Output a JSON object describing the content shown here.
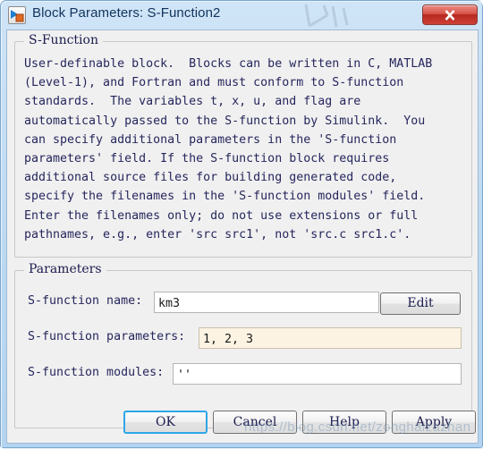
{
  "window": {
    "title": "Block Parameters: S-Function2",
    "icon": "simulink-block-icon",
    "close_label": "x",
    "frame_color": "#b3d4f0",
    "client_bg": "#f0f0f0"
  },
  "sfunction_group": {
    "legend": "S-Function",
    "description": "User-definable block.  Blocks can be written in C, MATLAB\n(Level-1), and Fortran and must conform to S-function\nstandards.  The variables t, x, u, and flag are\nautomatically passed to the S-function by Simulink.  You\ncan specify additional parameters in the 'S-function\nparameters' field. If the S-function block requires\nadditional source files for building generated code,\nspecify the filenames in the 'S-function modules' field.\nEnter the filenames only; do not use extensions or full\npathnames, e.g., enter 'src src1', not 'src.c src1.c'."
  },
  "parameters_group": {
    "legend": "Parameters",
    "fields": [
      {
        "label": "S-function name:",
        "value": "km3",
        "placeholder": "",
        "edited": false
      },
      {
        "label": "S-function parameters:",
        "value": "1, 2, 3",
        "placeholder": "",
        "edited": true
      },
      {
        "label": "S-function modules:",
        "value": "''",
        "placeholder": "",
        "edited": false
      }
    ],
    "edit_button": "Edit",
    "edited_field_color": "#fdf3e3"
  },
  "buttons": {
    "ok": "OK",
    "cancel": "Cancel",
    "help": "Help",
    "apply": "Apply",
    "default_focus_color": "#2ea6e8"
  },
  "watermark": {
    "text": "https://blog.csdn.net/zonghaizazhan"
  }
}
